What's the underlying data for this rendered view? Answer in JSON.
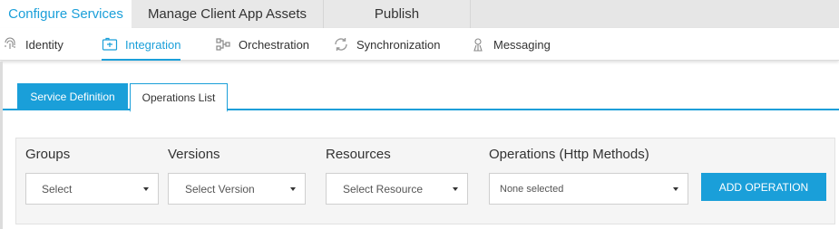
{
  "top_tabs": [
    {
      "label": "Configure Services",
      "active": true
    },
    {
      "label": "Manage Client App Assets",
      "active": false
    },
    {
      "label": "Publish",
      "active": false
    }
  ],
  "sub_nav": [
    {
      "label": "Identity",
      "icon": "fingerprint-icon",
      "active": false
    },
    {
      "label": "Integration",
      "icon": "integration-icon",
      "active": true
    },
    {
      "label": "Orchestration",
      "icon": "orchestration-icon",
      "active": false
    },
    {
      "label": "Synchronization",
      "icon": "sync-icon",
      "active": false
    },
    {
      "label": "Messaging",
      "icon": "messaging-icon",
      "active": false
    }
  ],
  "inner_tabs": [
    {
      "label": "Service Definition",
      "active": true
    },
    {
      "label": "Operations List",
      "active": false
    }
  ],
  "filters": {
    "groups": {
      "label": "Groups",
      "value": "Select"
    },
    "versions": {
      "label": "Versions",
      "value": "Select Version"
    },
    "resources": {
      "label": "Resources",
      "value": "Select Resource"
    },
    "operations": {
      "label": "Operations (Http Methods)",
      "value": "None selected"
    }
  },
  "add_button": "ADD OPERATION",
  "colors": {
    "accent": "#1a9fd9",
    "tab_bar": "#e6e6e6",
    "panel": "#f5f5f5"
  }
}
